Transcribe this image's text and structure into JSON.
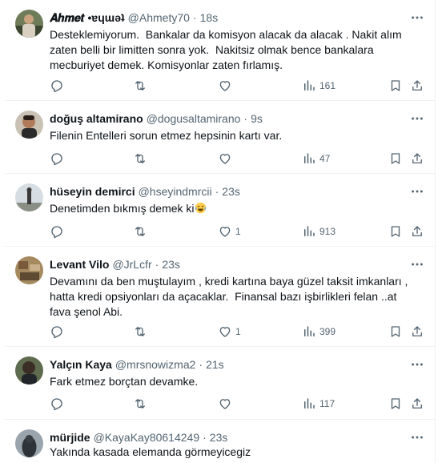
{
  "colors": {
    "text": "#0f1419",
    "secondary": "#536471",
    "divider": "#eff3f4",
    "background": "#ffffff"
  },
  "icons": {
    "reply": "reply-icon",
    "retweet": "retweet-icon",
    "like": "heart-icon",
    "views": "views-icon",
    "bookmark": "bookmark-icon",
    "share": "share-icon",
    "more": "more-icon"
  },
  "tweets": [
    {
      "name": "𝑨𝒉𝒎𝒆𝒕 •ɐɥɯǝʇ",
      "handle": "@Ahmety70",
      "time": "18s",
      "text": "Desteklemiyorum.  Bankalar da komisyon alacak da alacak . Nakit alım zaten belli bir limitten sonra yok.  Nakitsiz olmak bence bankalara mecburiyet demek. Komisyonlar zaten fırlamış.",
      "likes": "",
      "views": "161"
    },
    {
      "name": "doğuş altamirano",
      "handle": "@dogusaltamirano",
      "time": "9s",
      "text": "Filenin Entelleri sorun etmez hepsinin kartı var.",
      "likes": "",
      "views": "47"
    },
    {
      "name": "hüseyin demirci",
      "handle": "@hseyindmrcii",
      "time": "23s",
      "text": "Denetimden bıkmış demek ki",
      "likes": "1",
      "views": "913"
    },
    {
      "name": "Levant Vilo",
      "handle": "@JrLcfr",
      "time": "23s",
      "text": "Devamını da ben muştulayım , kredi kartına baya güzel taksit imkanları , hatta kredi opsiyonları da açacaklar.  Finansal bazı işbirlikleri felan ..at fava şenol Abi.",
      "likes": "1",
      "views": "399"
    },
    {
      "name": "Yalçın Kaya",
      "handle": "@mrsnowizma2",
      "time": "21s",
      "text": "Fark etmez borçtan devamke.",
      "likes": "",
      "views": "117"
    },
    {
      "name": "mürjide",
      "handle": "@KayaKay80614249",
      "time": "23s",
      "text": "Yakında kasada elemanda görmeyicegiz",
      "likes": "",
      "views": ""
    }
  ]
}
